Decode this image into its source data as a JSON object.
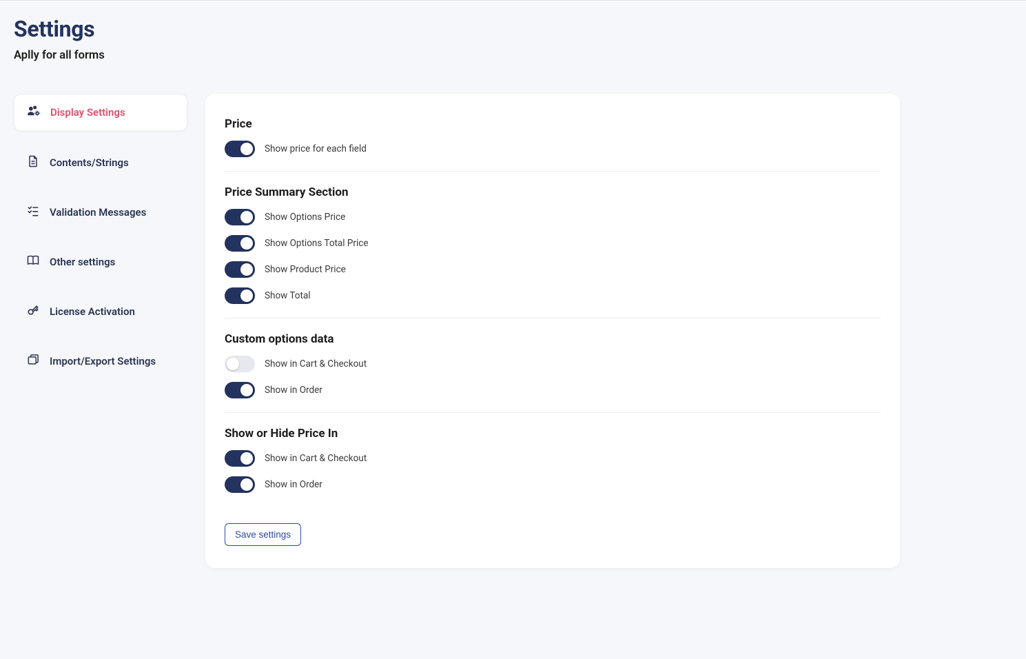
{
  "header": {
    "title": "Settings",
    "subtitle": "Aplly for all forms"
  },
  "sidebar": {
    "items": [
      {
        "label": "Display Settings",
        "active": true
      },
      {
        "label": "Contents/Strings",
        "active": false
      },
      {
        "label": "Validation Messages",
        "active": false
      },
      {
        "label": "Other settings",
        "active": false
      },
      {
        "label": "License Activation",
        "active": false
      },
      {
        "label": "Import/Export Settings",
        "active": false
      }
    ]
  },
  "panel": {
    "groups": [
      {
        "title": "Price",
        "toggles": [
          {
            "label": "Show price for each field",
            "on": true
          }
        ]
      },
      {
        "title": "Price Summary Section",
        "toggles": [
          {
            "label": "Show Options Price",
            "on": true
          },
          {
            "label": "Show Options Total Price",
            "on": true
          },
          {
            "label": "Show Product Price",
            "on": true
          },
          {
            "label": "Show Total",
            "on": true
          }
        ]
      },
      {
        "title": "Custom options data",
        "toggles": [
          {
            "label": "Show in Cart & Checkout",
            "on": false
          },
          {
            "label": "Show in Order",
            "on": true
          }
        ]
      },
      {
        "title": "Show or Hide Price In",
        "toggles": [
          {
            "label": "Show in Cart & Checkout",
            "on": true
          },
          {
            "label": "Show in Order",
            "on": true
          }
        ]
      }
    ],
    "save_label": "Save settings"
  }
}
